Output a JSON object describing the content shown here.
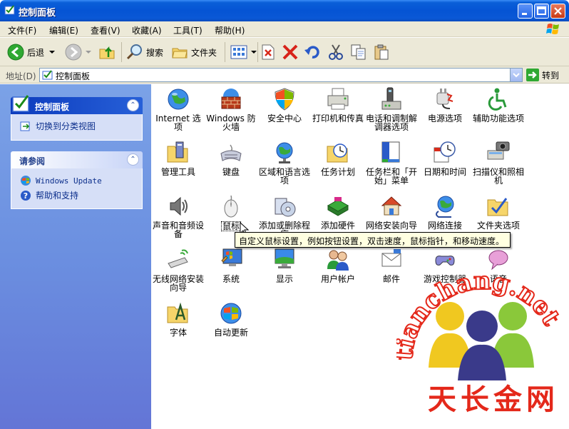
{
  "window": {
    "title": "控制面板"
  },
  "menu": [
    {
      "label": "文件(F)"
    },
    {
      "label": "编辑(E)"
    },
    {
      "label": "查看(V)"
    },
    {
      "label": "收藏(A)"
    },
    {
      "label": "工具(T)"
    },
    {
      "label": "帮助(H)"
    }
  ],
  "toolbar": {
    "back_label": "后退",
    "search_label": "搜索",
    "folders_label": "文件夹"
  },
  "address": {
    "label": "地址(D)",
    "value": "控制面板",
    "go_label": "转到"
  },
  "left_pane": {
    "control_panel_title": "控制面板",
    "switch_view_link": "切换到分类视图",
    "see_also_title": "请参阅",
    "see_also_links": [
      "Windows Update",
      "帮助和支持"
    ]
  },
  "items": [
    "Internet 选项",
    "Windows 防火墙",
    "安全中心",
    "打印机和传真",
    "电话和调制解调器选项",
    "电源选项",
    "辅助功能选项",
    "管理工具",
    "键盘",
    "区域和语言选项",
    "任务计划",
    "任务栏和「开始」菜单",
    "日期和时间",
    "扫描仪和照相机",
    "声音和音频设备",
    "鼠标",
    "添加或删除程序",
    "添加硬件",
    "网络安装向导",
    "网络连接",
    "文件夹选项",
    "无线网络安装向导",
    "系统",
    "显示",
    "用户帐户",
    "邮件",
    "游戏控制器",
    "语音",
    "字体",
    "自动更新"
  ],
  "tooltip": "自定义鼠标设置，例如按钮设置，双击速度，鼠标指针，和移动速度。",
  "watermark": {
    "url_text": "tianchang.net",
    "cn_text": "天长金网"
  },
  "colors": {
    "xp_blue": "#0554d4",
    "left_pane": "#6b8fe0",
    "panel_bg": "#d6dff7",
    "watermark_red": "#e4281a"
  }
}
